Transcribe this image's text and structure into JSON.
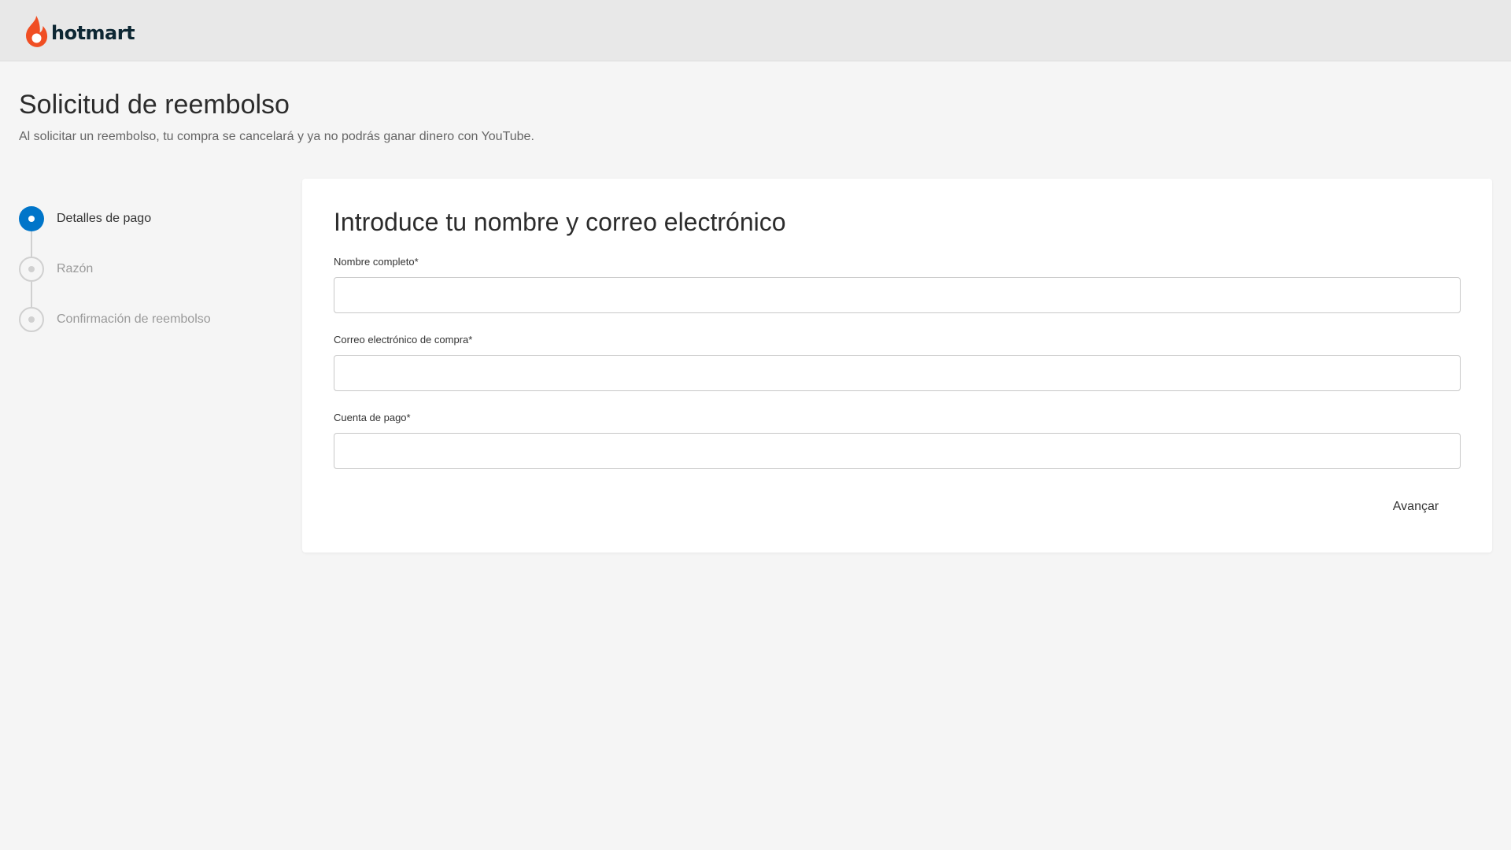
{
  "header": {
    "brand_name": "hotmart",
    "logo_icon": "flame-logo-icon",
    "brand_color": "#f04e23"
  },
  "page": {
    "title": "Solicitud de reembolso",
    "subtitle": "Al solicitar un reembolso, tu compra se cancelará y ya no podrás ganar dinero con YouTube."
  },
  "stepper": {
    "active_color": "#0075c9",
    "steps": [
      {
        "label": "Detalles de pago",
        "state": "active"
      },
      {
        "label": "Razón",
        "state": "inactive"
      },
      {
        "label": "Confirmación de reembolso",
        "state": "inactive"
      }
    ]
  },
  "form": {
    "title": "Introduce tu nombre y correo electrónico",
    "fields": [
      {
        "label": "Nombre completo*",
        "value": "",
        "placeholder": ""
      },
      {
        "label": "Correo electrónico de compra*",
        "value": "",
        "placeholder": ""
      },
      {
        "label": "Cuenta de pago*",
        "value": "",
        "placeholder": ""
      }
    ],
    "submit_label": "Avançar"
  }
}
